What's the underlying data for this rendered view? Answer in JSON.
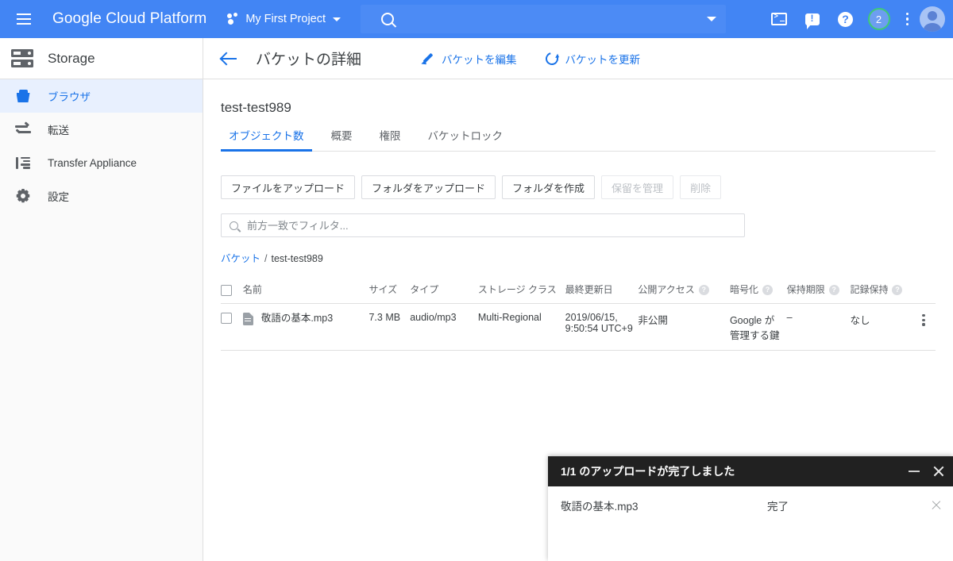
{
  "topbar": {
    "menu_icon": "hamburger-icon",
    "brand": "Google Cloud Platform",
    "project_icon": "project-dots-icon",
    "project_name": "My First Project",
    "project_caret": "chevron-down-icon",
    "search": {
      "value": "",
      "placeholder": "",
      "icon": "search-icon",
      "caret": "chevron-down-icon"
    },
    "actions": {
      "cloud_shell": "cloud-shell-icon",
      "feedback": "feedback-icon",
      "help": "help-icon",
      "notifications_count": "2",
      "more": "kebab-icon",
      "account": "avatar-icon"
    },
    "bg_color": "#4285f4",
    "search_bg": "#4c8bf5",
    "badge_ring_color": "#3ec978"
  },
  "sidebar": {
    "product_icon": "storage-server-icon",
    "product_title": "Storage",
    "items": [
      {
        "label": "ブラウザ",
        "icon": "bucket-icon",
        "active": true
      },
      {
        "label": "転送",
        "icon": "transfer-arrows-icon",
        "active": false
      },
      {
        "label": "Transfer Appliance",
        "icon": "appliance-icon",
        "active": false
      },
      {
        "label": "設定",
        "icon": "gear-icon",
        "active": false
      }
    ],
    "active_bg": "#e8f0fe",
    "active_color": "#1a73e8"
  },
  "page": {
    "back_icon": "arrow-back-icon",
    "title": "バケットの詳細",
    "actions": [
      {
        "label": "バケットを編集",
        "icon": "pencil-icon"
      },
      {
        "label": "バケットを更新",
        "icon": "refresh-icon"
      }
    ],
    "bucket_name": "test-test989",
    "tabs": [
      {
        "label": "オブジェクト数",
        "active": true
      },
      {
        "label": "概要",
        "active": false
      },
      {
        "label": "権限",
        "active": false
      },
      {
        "label": "バケットロック",
        "active": false
      }
    ],
    "buttons": [
      {
        "label": "ファイルをアップロード",
        "disabled": false
      },
      {
        "label": "フォルダをアップロード",
        "disabled": false
      },
      {
        "label": "フォルダを作成",
        "disabled": false
      },
      {
        "label": "保留を管理",
        "disabled": true
      },
      {
        "label": "削除",
        "disabled": true
      }
    ],
    "filter": {
      "placeholder": "前方一致でフィルタ...",
      "value": "",
      "icon": "search-icon"
    },
    "breadcrumb": {
      "root": "バケット",
      "separator": "/",
      "current": "test-test989"
    }
  },
  "table": {
    "columns": [
      {
        "label": "名前",
        "help": false
      },
      {
        "label": "サイズ",
        "help": false
      },
      {
        "label": "タイプ",
        "help": false
      },
      {
        "label": "ストレージ クラス",
        "help": false
      },
      {
        "label": "最終更新日",
        "help": false
      },
      {
        "label": "公開アクセス",
        "help": true
      },
      {
        "label": "暗号化",
        "help": true
      },
      {
        "label": "保持期限",
        "help": true
      },
      {
        "label": "記録保持",
        "help": true
      }
    ],
    "help_glyph": "?",
    "rows": [
      {
        "name": "敬語の基本.mp3",
        "file_icon": "file-icon",
        "size": "7.3 MB",
        "type": "audio/mp3",
        "storage_class": "Multi-Regional",
        "last_modified": "2019/06/15, 9:50:54 UTC+9",
        "public_access": "非公開",
        "encryption": "Google が管理する鍵",
        "retention": "–",
        "hold": "なし",
        "row_menu_icon": "kebab-icon"
      }
    ]
  },
  "uploader": {
    "title": "1/1 のアップロードが完了しました",
    "minimize_icon": "minimize-icon",
    "close_icon": "close-icon",
    "rows": [
      {
        "file_name": "敬語の基本.mp3",
        "status": "完了",
        "dismiss_icon": "close-icon"
      }
    ],
    "header_bg": "#212121"
  }
}
